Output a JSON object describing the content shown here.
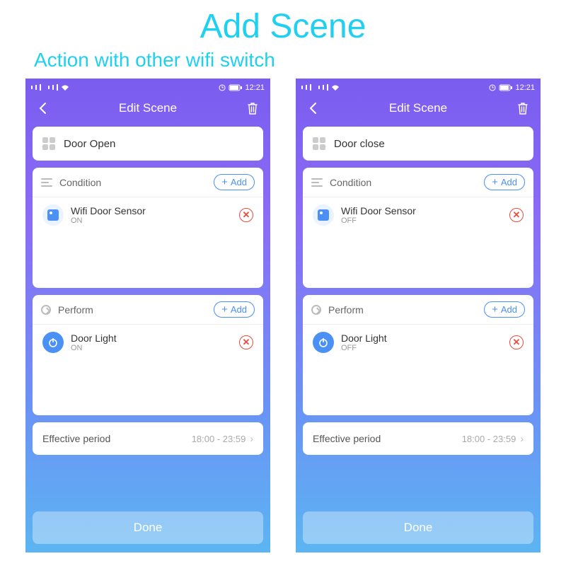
{
  "heading": "Add Scene",
  "subheading": "Action with other wifi switch",
  "status_time": "12:21",
  "screens": [
    {
      "header": "Edit Scene",
      "scene_name": "Door Open",
      "condition": {
        "title": "Condition",
        "add": "Add",
        "item": {
          "name": "Wifi Door Sensor",
          "state": "ON"
        }
      },
      "perform": {
        "title": "Perform",
        "add": "Add",
        "item": {
          "name": "Door Light",
          "state": "ON"
        }
      },
      "effective": {
        "label": "Effective period",
        "value": "18:00 - 23:59"
      },
      "done": "Done"
    },
    {
      "header": "Edit Scene",
      "scene_name": "Door close",
      "condition": {
        "title": "Condition",
        "add": "Add",
        "item": {
          "name": "Wifi Door Sensor",
          "state": "OFF"
        }
      },
      "perform": {
        "title": "Perform",
        "add": "Add",
        "item": {
          "name": "Door Light",
          "state": "OFF"
        }
      },
      "effective": {
        "label": "Effective period",
        "value": "18:00 - 23:59"
      },
      "done": "Done"
    }
  ]
}
